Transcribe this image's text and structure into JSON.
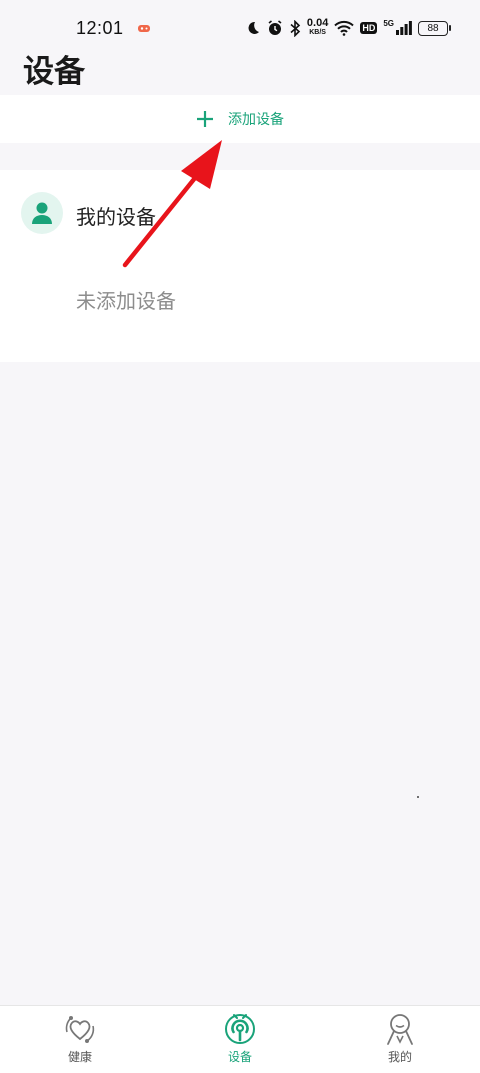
{
  "status_bar": {
    "time": "12:01",
    "net_speed_value": "0.04",
    "net_speed_unit": "KB/S",
    "hd_label": "HD",
    "network_gen": "5G",
    "battery": "88"
  },
  "page": {
    "title": "设备",
    "add_device_label": "添加设备"
  },
  "device_section": {
    "title": "我的设备",
    "empty_text": "未添加设备"
  },
  "tabs": [
    {
      "label": "健康",
      "icon": "health-heart-icon",
      "active": false
    },
    {
      "label": "设备",
      "icon": "device-signal-icon",
      "active": true
    },
    {
      "label": "我的",
      "icon": "profile-person-icon",
      "active": false
    }
  ],
  "colors": {
    "accent": "#1aa37a",
    "annotation_arrow": "#e8141b",
    "background": "#f7f6f9"
  }
}
